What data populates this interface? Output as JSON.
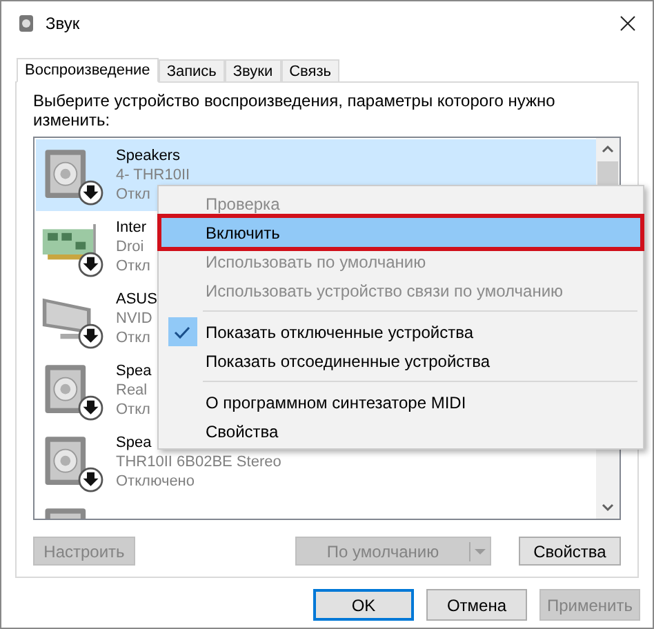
{
  "window": {
    "title": "Звук"
  },
  "tabs": [
    {
      "label": "Воспроизведение",
      "selected": true
    },
    {
      "label": "Запись",
      "selected": false
    },
    {
      "label": "Звуки",
      "selected": false
    },
    {
      "label": "Связь",
      "selected": false
    }
  ],
  "instruction": "Выберите устройство воспроизведения, параметры которого нужно изменить:",
  "devices": [
    {
      "kind": "speaker",
      "name": "Speakers",
      "detail": "4- THR10II",
      "status": "Откл",
      "selected": true
    },
    {
      "kind": "card",
      "name": "Inter",
      "detail": "Droi",
      "status": "Откл",
      "selected": false
    },
    {
      "kind": "monitor",
      "name": "ASUS",
      "detail": "NVID",
      "status": "Откл",
      "selected": false
    },
    {
      "kind": "speaker",
      "name": "Spea",
      "detail": "Real",
      "status": "Откл",
      "selected": false
    },
    {
      "kind": "speaker",
      "name": "Spea",
      "detail": "THR10II 6B02BE Stereo",
      "status": "Отключено",
      "selected": false
    },
    {
      "kind": "speaker",
      "selected": false
    }
  ],
  "context_menu": [
    {
      "kind": "item",
      "label": "Проверка",
      "disabled": true,
      "checked": false,
      "selected": false,
      "outlined": false
    },
    {
      "kind": "item",
      "label": "Включить",
      "disabled": false,
      "checked": false,
      "selected": true,
      "outlined": true
    },
    {
      "kind": "item",
      "label": "Использовать по умолчанию",
      "disabled": true,
      "checked": false,
      "selected": false,
      "outlined": false
    },
    {
      "kind": "item",
      "label": "Использовать устройство связи по умолчанию",
      "disabled": true,
      "checked": false,
      "selected": false,
      "outlined": false
    },
    {
      "kind": "separator"
    },
    {
      "kind": "item",
      "label": "Показать отключенные устройства",
      "disabled": false,
      "checked": true,
      "selected": false,
      "outlined": false
    },
    {
      "kind": "item",
      "label": "Показать отсоединенные устройства",
      "disabled": false,
      "checked": false,
      "selected": false,
      "outlined": false
    },
    {
      "kind": "separator"
    },
    {
      "kind": "item",
      "label": "О программном синтезаторе MIDI",
      "disabled": false,
      "checked": false,
      "selected": false,
      "outlined": false
    },
    {
      "kind": "item",
      "label": "Свойства",
      "disabled": false,
      "checked": false,
      "selected": false,
      "outlined": false
    }
  ],
  "panel_buttons": [
    {
      "kind": "plain",
      "label": "Настроить",
      "disabled": true
    },
    {
      "kind": "spacer"
    },
    {
      "kind": "split",
      "label": "По умолчанию",
      "disabled": true
    },
    {
      "kind": "plain",
      "label": "Свойства",
      "disabled": false
    }
  ],
  "dialog_buttons": [
    {
      "label": "OK",
      "disabled": false,
      "focused": true
    },
    {
      "label": "Отмена",
      "disabled": false,
      "focused": false
    },
    {
      "label": "Применить",
      "disabled": true,
      "focused": false
    }
  ]
}
